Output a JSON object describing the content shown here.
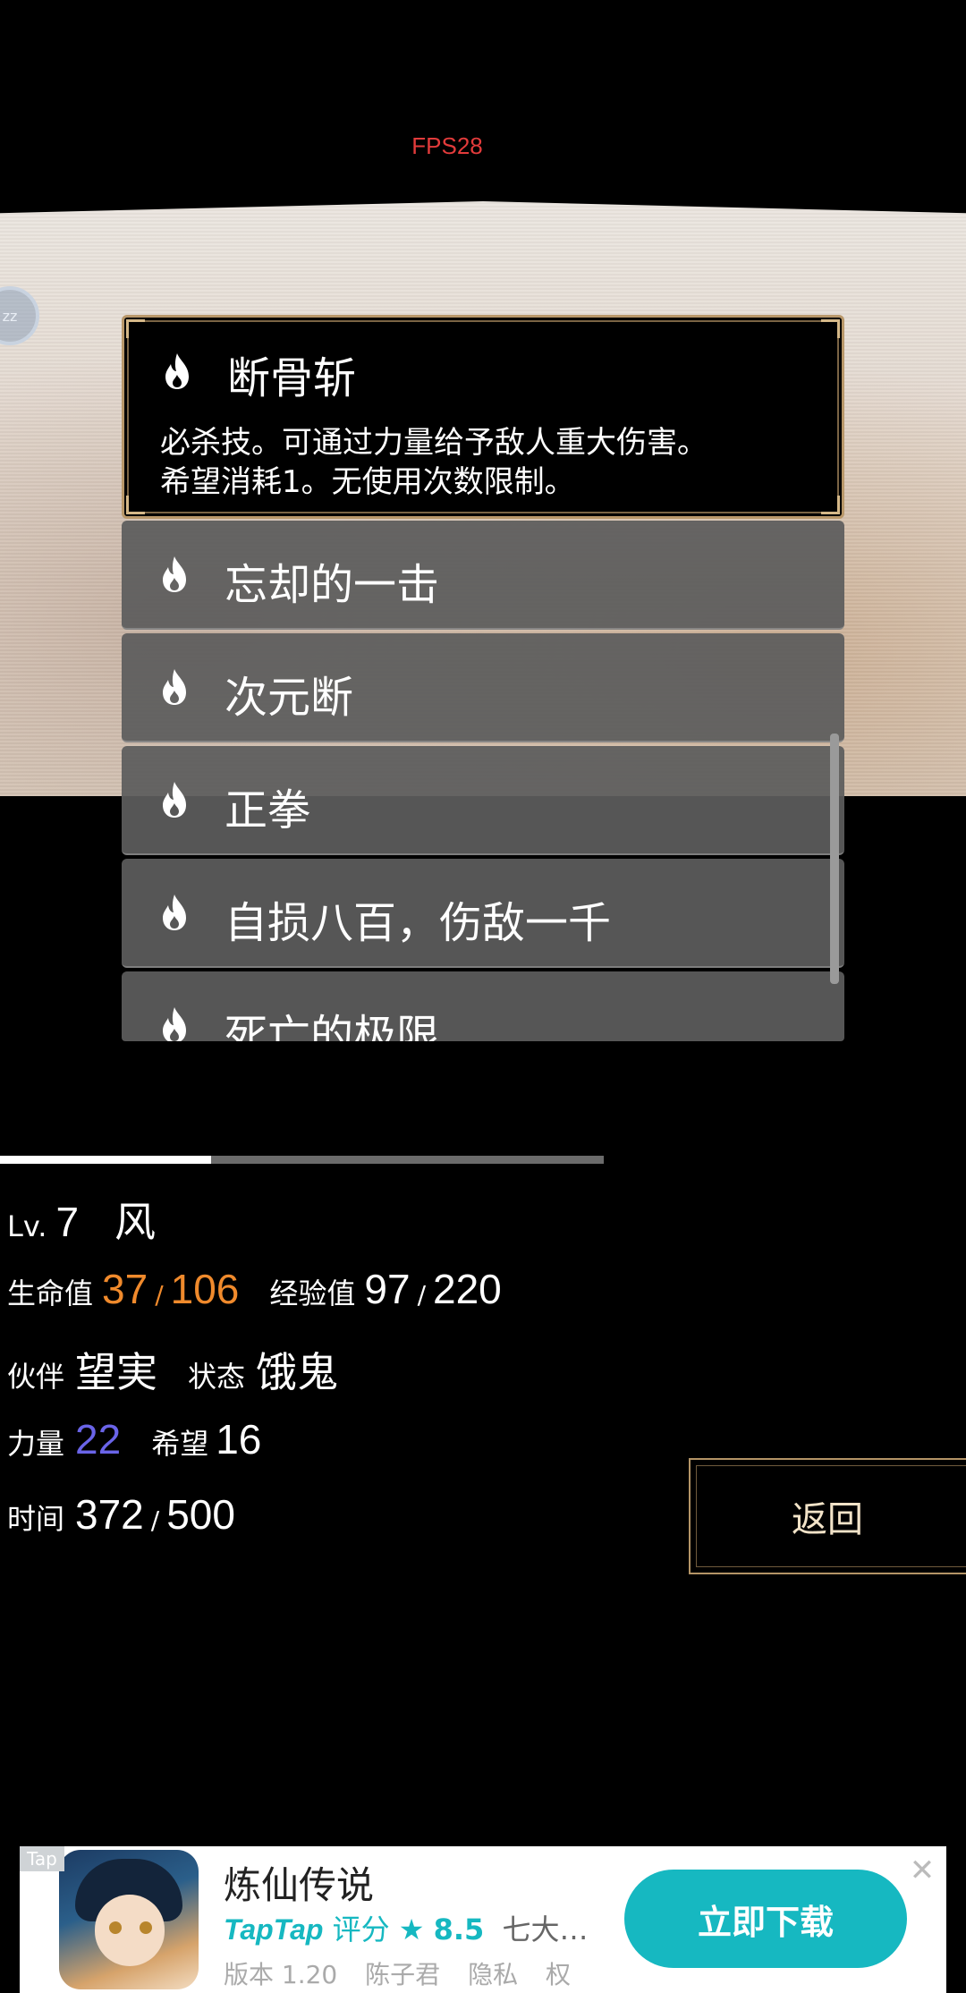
{
  "fps": "FPS28",
  "status_badge": "zz",
  "skills": {
    "selected": {
      "name": "断骨斩",
      "description_line1": "必杀技。可通过力量给予敌人重大伤害。",
      "description_line2": "希望消耗1。无使用次数限制。"
    },
    "items": [
      {
        "name": "忘却的一击"
      },
      {
        "name": "次元断"
      },
      {
        "name": "正拳"
      },
      {
        "name": "自损八百，伤敌一千"
      },
      {
        "name": "死亡的极限"
      }
    ],
    "icon": "flame-icon"
  },
  "progress": {
    "fraction": 0.35
  },
  "stats": {
    "level_label": "Lv.",
    "level": "7",
    "name": "风",
    "hp_label": "生命值",
    "hp_current": "37",
    "hp_max": "106",
    "exp_label": "经验值",
    "exp_current": "97",
    "exp_max": "220",
    "partner_label": "伙伴",
    "partner": "望実",
    "status_label": "状态",
    "status": "饿鬼",
    "strength_label": "力量",
    "strength": "22",
    "hope_label": "希望",
    "hope": "16",
    "time_label": "时间",
    "time_current": "372",
    "time_max": "500",
    "slash": "/"
  },
  "back_button": "返回",
  "ad": {
    "tag": "Tap",
    "title": "炼仙传说",
    "brand": "TapTap",
    "rating_label": "评分",
    "rating_star": "★",
    "rating": "8.5",
    "rating_desc": "七大…",
    "version": "版本 1.20",
    "developer": "陈子君",
    "privacy": "隐私",
    "trailing": "权",
    "cta": "立即下载",
    "close": "✕"
  },
  "colors": {
    "hp_accent": "#f08a2c",
    "strength_accent": "#6a64e8",
    "cta": "#16b8c1",
    "frame_gold": "#b9986a"
  }
}
